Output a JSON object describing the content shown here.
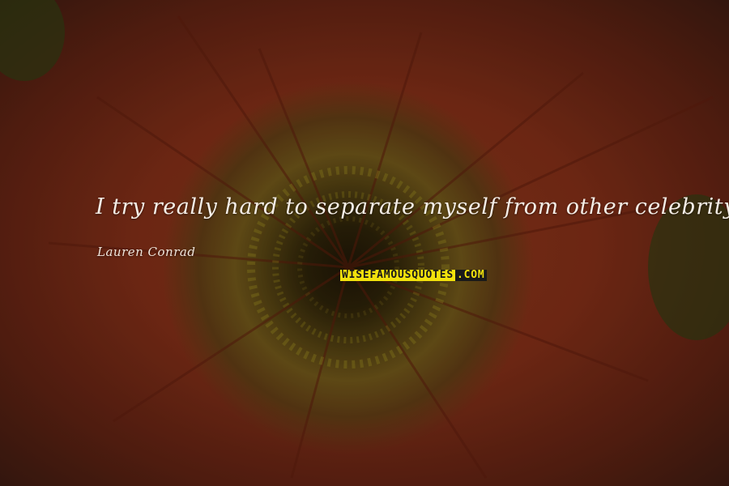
{
  "quote": {
    "text": "I try really hard to separate myself from other celebrity brands.",
    "author": "Lauren Conrad"
  },
  "watermark": {
    "part1": "WISEFAMOUSQUOTES",
    "part2": ".COM"
  },
  "colors": {
    "text": "#f4ede6",
    "watermark_yellow": "#f2e20c",
    "watermark_dark": "#1a1a1a",
    "petal": "#8a3418"
  }
}
